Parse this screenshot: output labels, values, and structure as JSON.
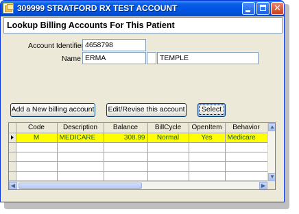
{
  "window": {
    "title": "309999 STRATFORD RX TEST ACCOUNT",
    "minimize_glyph": "_",
    "maximize_glyph": "□",
    "close_glyph": "✕"
  },
  "header": {
    "title": "Lookup Billing Accounts For This Patient"
  },
  "form": {
    "account_identifier_label": "Account Identifier",
    "account_identifier_value": "4658798",
    "name_label": "Name",
    "first_name": "ERMA",
    "middle_initial": "",
    "last_name": "TEMPLE"
  },
  "buttons": {
    "add_new_billing_account": "Add a New billing account",
    "edit_revise": "Edit/Revise this account",
    "select": "Select"
  },
  "grid": {
    "columns": [
      "Code",
      "Description",
      "Balance",
      "BillCycle",
      "OpenItem",
      "Behavior"
    ],
    "rows": [
      {
        "code": "M",
        "description": "MEDICARE",
        "balance": "308.99",
        "billcycle": "Normal",
        "openitem": "Yes",
        "behavior": "Medicare"
      }
    ],
    "selected_row_color": "#ffff00",
    "selected_row_text_color": "#1b5c2a"
  },
  "scrollbars": {
    "left_arrow": "◀",
    "right_arrow": "▶",
    "up_arrow": "▲",
    "down_arrow": "▼"
  },
  "colors": {
    "titlebar": "#0054e3",
    "window_bg": "#ece9d8",
    "field_border": "#7f9db9"
  }
}
